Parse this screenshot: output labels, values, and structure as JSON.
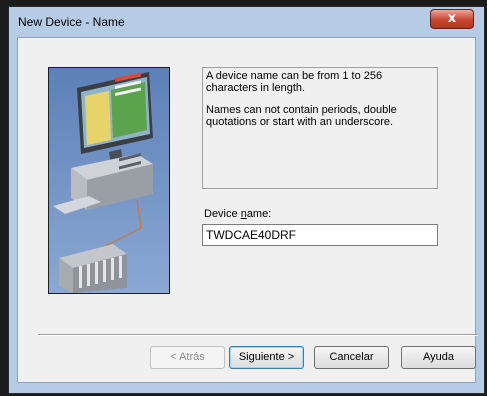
{
  "window": {
    "title": "New Device - Name",
    "close_glyph": "x"
  },
  "info": {
    "line1": "A device name can be from 1 to 256 characters in length.",
    "line2": "Names can not contain periods, double quotations or start with an underscore."
  },
  "field": {
    "label_before": "Device ",
    "label_access_key": "n",
    "label_after": "ame:",
    "value": "TWDCAE40DRF"
  },
  "buttons": {
    "back": "< Atrás",
    "next": "Siguiente >",
    "cancel": "Cancelar",
    "help": "Ayuda"
  },
  "illustration": {
    "icon": "device-network-illustration"
  }
}
